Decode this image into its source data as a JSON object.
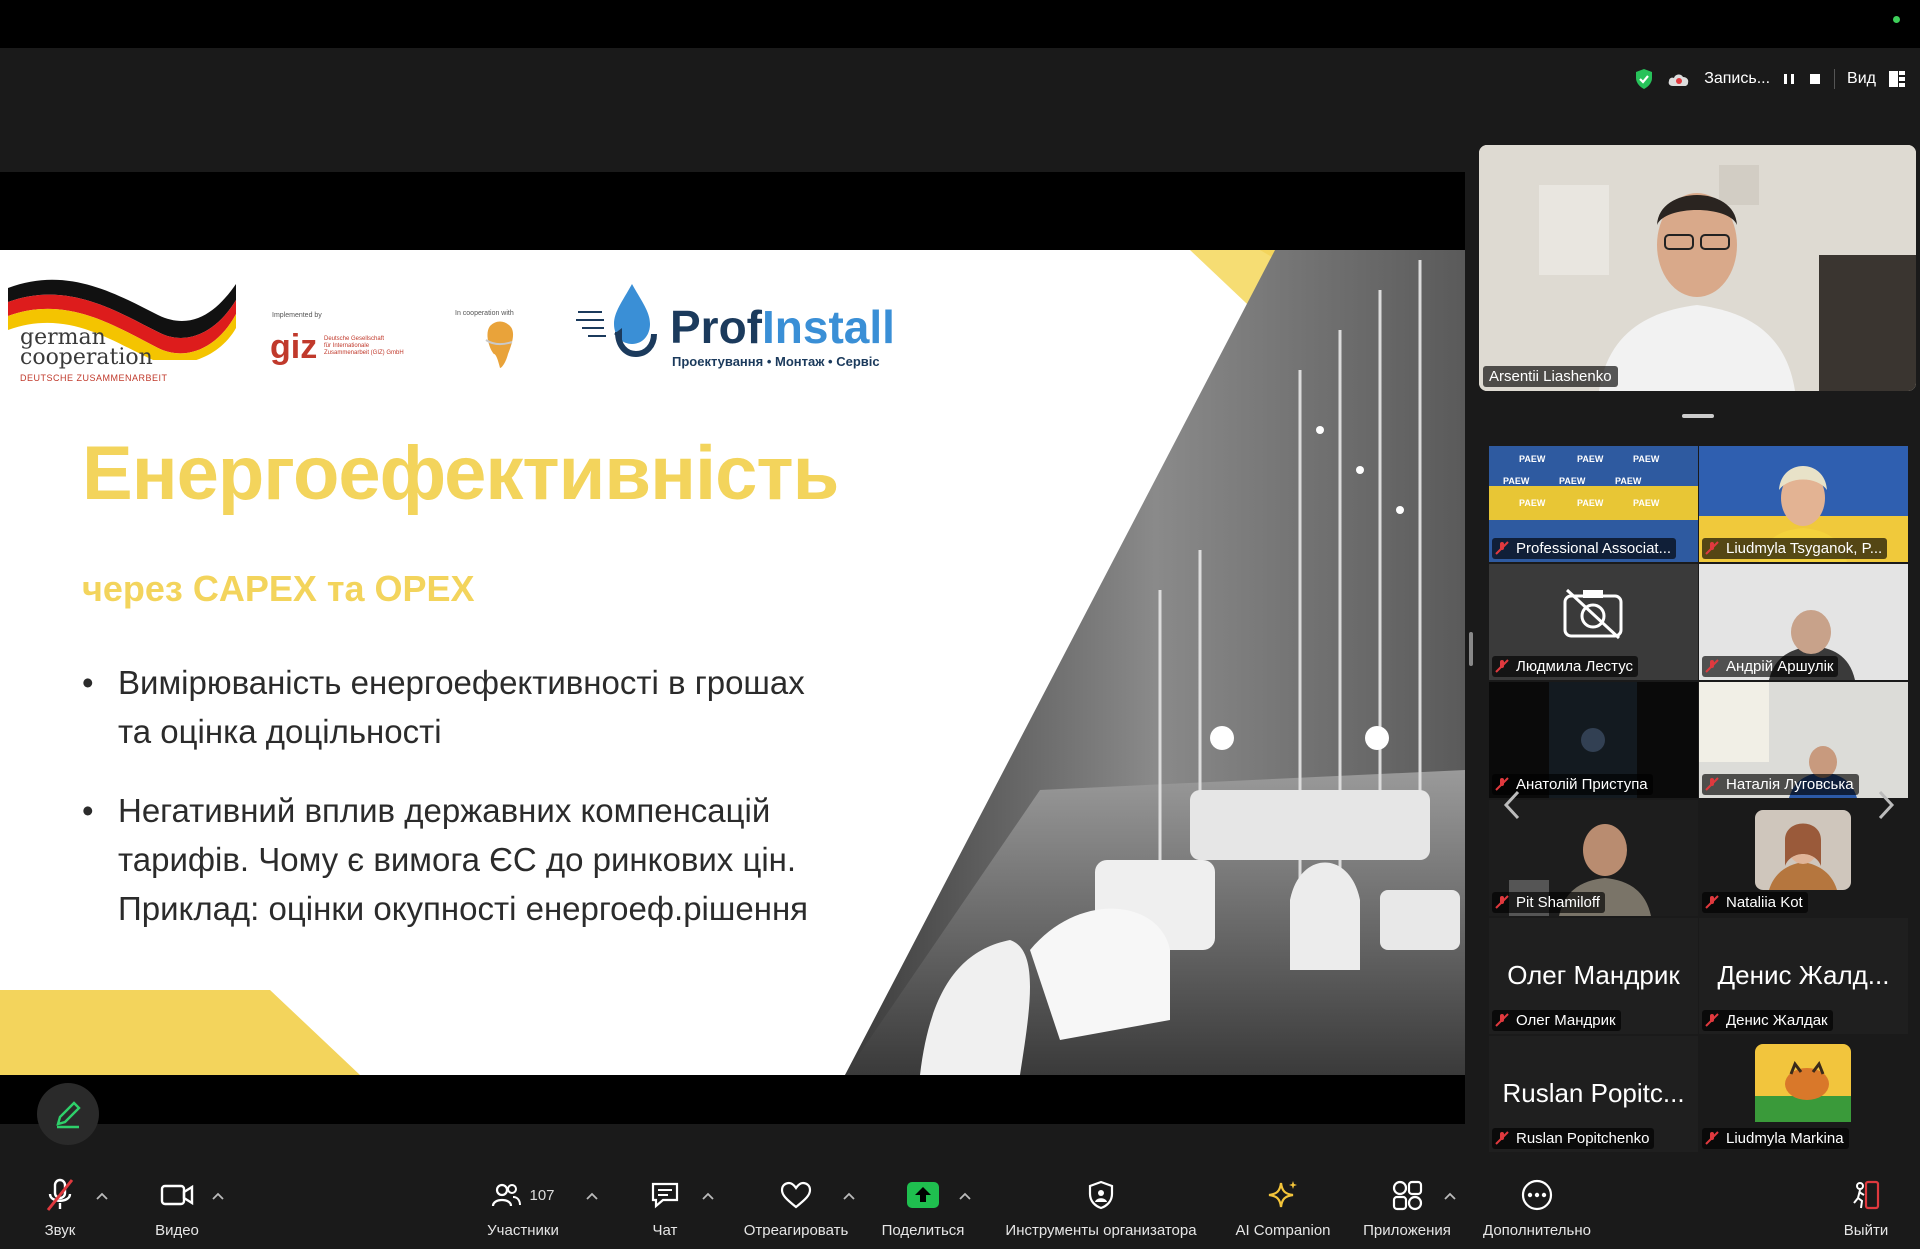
{
  "topbar": {
    "recording_label": "Запись...",
    "view_label": "Вид"
  },
  "slide": {
    "title": "Енергоефективність",
    "subtitle": "через CAPEX та OPEX",
    "bullets": [
      [
        "Вимірюваність енергоефективності в грошах",
        "та оцінка доцільності"
      ],
      [
        "Негативний вплив державних компенсацій",
        "тарифів. Чому є вимога ЄС до ринкових цін.",
        "Приклад: оцінки окупності енергоеф.рішення"
      ]
    ],
    "logos": {
      "german_cooperation_1": "german",
      "german_cooperation_2": "cooperation",
      "german_cooperation_3": "DEUTSCHE ZUSAMMENARBEIT",
      "implemented_by": "Implemented by",
      "giz": "giz",
      "giz_desc_1": "Deutsche Gesellschaft",
      "giz_desc_2": "für Internationale",
      "giz_desc_3": "Zusammenarbeit (GIZ) GmbH",
      "in_cooperation_with": "In cooperation with",
      "profinstall_prof": "Prof",
      "profinstall_install": "Install",
      "profinstall_tagline": "Проектування • Монтаж • Сервіс"
    }
  },
  "speaker": {
    "name": "Arsentii Liashenko"
  },
  "participants": [
    {
      "name": "Professional Associat...",
      "kind": "paew"
    },
    {
      "name": "Liudmyla Tsyganok, P...",
      "kind": "video"
    },
    {
      "name": "Людмила Лестус",
      "kind": "camera-off"
    },
    {
      "name": "Андрій Аршулік",
      "kind": "video"
    },
    {
      "name": "Анатолій Приступа",
      "kind": "dark"
    },
    {
      "name": "Наталія Луговська",
      "kind": "video"
    },
    {
      "name": "Pit Shamiloff",
      "kind": "video"
    },
    {
      "name": "Nataliia Kot",
      "kind": "avatar"
    },
    {
      "name": "Олег Мандрик",
      "big": "Олег Мандрик",
      "kind": "text"
    },
    {
      "name": "Денис Жалдак",
      "big": "Денис Жалд...",
      "kind": "text"
    },
    {
      "name": "Ruslan Popitchenko",
      "big": "Ruslan Popitc...",
      "kind": "text"
    },
    {
      "name": "Liudmyla Markina",
      "kind": "avatar2"
    }
  ],
  "paew_label": "PAEW",
  "toolbar": {
    "audio": "Звук",
    "video": "Видео",
    "participants": "Участники",
    "participants_count": "107",
    "chat": "Чат",
    "react": "Отреагировать",
    "share": "Поделиться",
    "host_tools": "Инструменты организатора",
    "ai": "AI Companion",
    "apps": "Приложения",
    "more": "Дополнительно",
    "leave": "Выйти"
  },
  "colors": {
    "accent_yellow": "#f3d45c",
    "share_green": "#1fbf4f",
    "leave_red": "#e0393e"
  }
}
